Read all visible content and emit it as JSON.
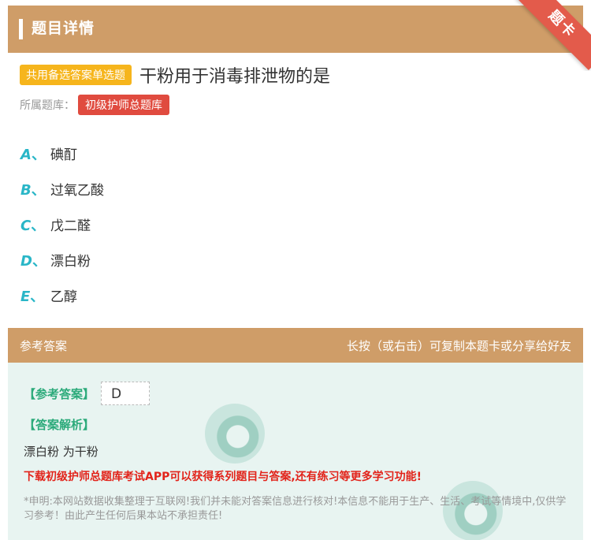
{
  "header": {
    "title": "题目详情",
    "corner_ribbon": "题卡"
  },
  "question": {
    "type_badge": "共用备选答案单选题",
    "title": "干粉用于消毒排泄物的是",
    "bank_label": "所属题库：",
    "bank_name": "初级护师总题库"
  },
  "options": [
    {
      "letter": "A",
      "sep": "、",
      "text": "碘酊"
    },
    {
      "letter": "B",
      "sep": "、",
      "text": "过氧乙酸"
    },
    {
      "letter": "C",
      "sep": "、",
      "text": "戊二醛"
    },
    {
      "letter": "D",
      "sep": "、",
      "text": "漂白粉"
    },
    {
      "letter": "E",
      "sep": "、",
      "text": "乙醇"
    }
  ],
  "answer_section": {
    "header_left": "参考答案",
    "header_right": "长按（或右击）可复制本题卡或分享给好友",
    "answer_label": "【参考答案】",
    "answer_value": "D",
    "analysis_label": "【答案解析】",
    "analysis_text": "漂白粉 为干粉",
    "promo": "下载初级护师总题库考试APP可以获得系列题目与答案,还有练习等更多学习功能!",
    "disclaimer": "*申明:本网站数据收集整理于互联网!我们并未能对答案信息进行核对!本信息不能用于生产、生活、考试等情境中,仅供学习参考！由此产生任何后果本站不承担责任!"
  },
  "colors": {
    "header_bg": "#cf9d68",
    "ribbon": "#e35b4b",
    "type_badge": "#f6b51c",
    "bank_badge": "#e04b3f",
    "option_letter": "#29b6c7",
    "answer_label": "#2baa7a",
    "promo": "#e2231a",
    "answer_bg": "#e8f4f1"
  }
}
